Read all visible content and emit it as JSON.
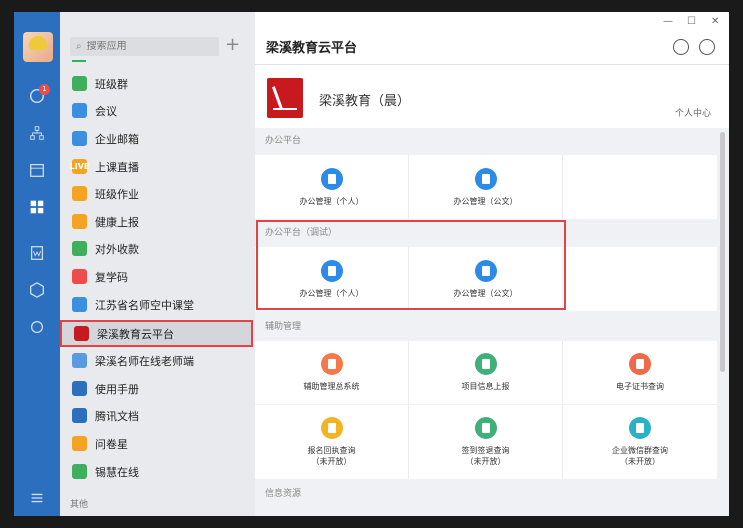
{
  "rail": {
    "badge": "1",
    "icons": [
      "chat-icon",
      "org-icon",
      "calendar-icon",
      "apps-icon",
      "doc-icon",
      "cube-icon",
      "cloud-icon",
      "menu-icon"
    ]
  },
  "applist": {
    "search_placeholder": "搜索应用",
    "items": [
      {
        "label": "班级群",
        "color": "#3fae5d"
      },
      {
        "label": "会议",
        "color": "#3c8fe0"
      },
      {
        "label": "企业邮箱",
        "color": "#3c8fe0"
      },
      {
        "label": "上课直播",
        "color": "#f4a422",
        "tag": "LIVE"
      },
      {
        "label": "班级作业",
        "color": "#f4a422"
      },
      {
        "label": "健康上报",
        "color": "#f4a422"
      },
      {
        "label": "对外收款",
        "color": "#3fae5d"
      },
      {
        "label": "复学码",
        "color": "#f04b4b"
      },
      {
        "label": "江苏省名师空中课堂",
        "color": "#3c8fe0"
      },
      {
        "label": "梁溪教育云平台",
        "color": "#c8191f"
      },
      {
        "label": "梁溪名师在线老师端",
        "color": "#5a9ae0"
      },
      {
        "label": "使用手册",
        "color": "#2c6fbf"
      },
      {
        "label": "腾讯文档",
        "color": "#2c6fbf"
      },
      {
        "label": "问卷星",
        "color": "#f4a422"
      },
      {
        "label": "锡慧在线",
        "color": "#3fae5d"
      }
    ],
    "other_label": "其他"
  },
  "content": {
    "title": "梁溪教育云平台",
    "banner_name": "梁溪教育（晨）",
    "personal_center": "个人中心",
    "sections": [
      {
        "head": "办公平台",
        "cells": [
          {
            "label": "办公管理（个人）",
            "color": "#2c8be6"
          },
          {
            "label": "办公管理（公文）",
            "color": "#2c8be6"
          },
          {
            "label": "",
            "color": ""
          }
        ]
      },
      {
        "head": "办公平台（调试）",
        "cells": [
          {
            "label": "办公管理（个人）",
            "color": "#2c8be6"
          },
          {
            "label": "办公管理（公文）",
            "color": "#2c8be6"
          },
          {
            "label": "",
            "color": ""
          }
        ]
      },
      {
        "head": "辅助管理",
        "cells": [
          {
            "label": "辅助管理总系统",
            "color": "#f27a4a"
          },
          {
            "label": "项目信息上报",
            "color": "#3fb07a"
          },
          {
            "label": "电子证书查询",
            "color": "#f06a4a"
          }
        ]
      },
      {
        "head": "",
        "cells": [
          {
            "label": "报名回执查询",
            "sub": "（未开放）",
            "color": "#f4b322"
          },
          {
            "label": "签到签退查询",
            "sub": "（未开放）",
            "color": "#3fb07a"
          },
          {
            "label": "企业微信群查询",
            "sub": "（未开放）",
            "color": "#2ab0c8"
          }
        ]
      },
      {
        "head": "信息资源",
        "cells": []
      }
    ]
  }
}
